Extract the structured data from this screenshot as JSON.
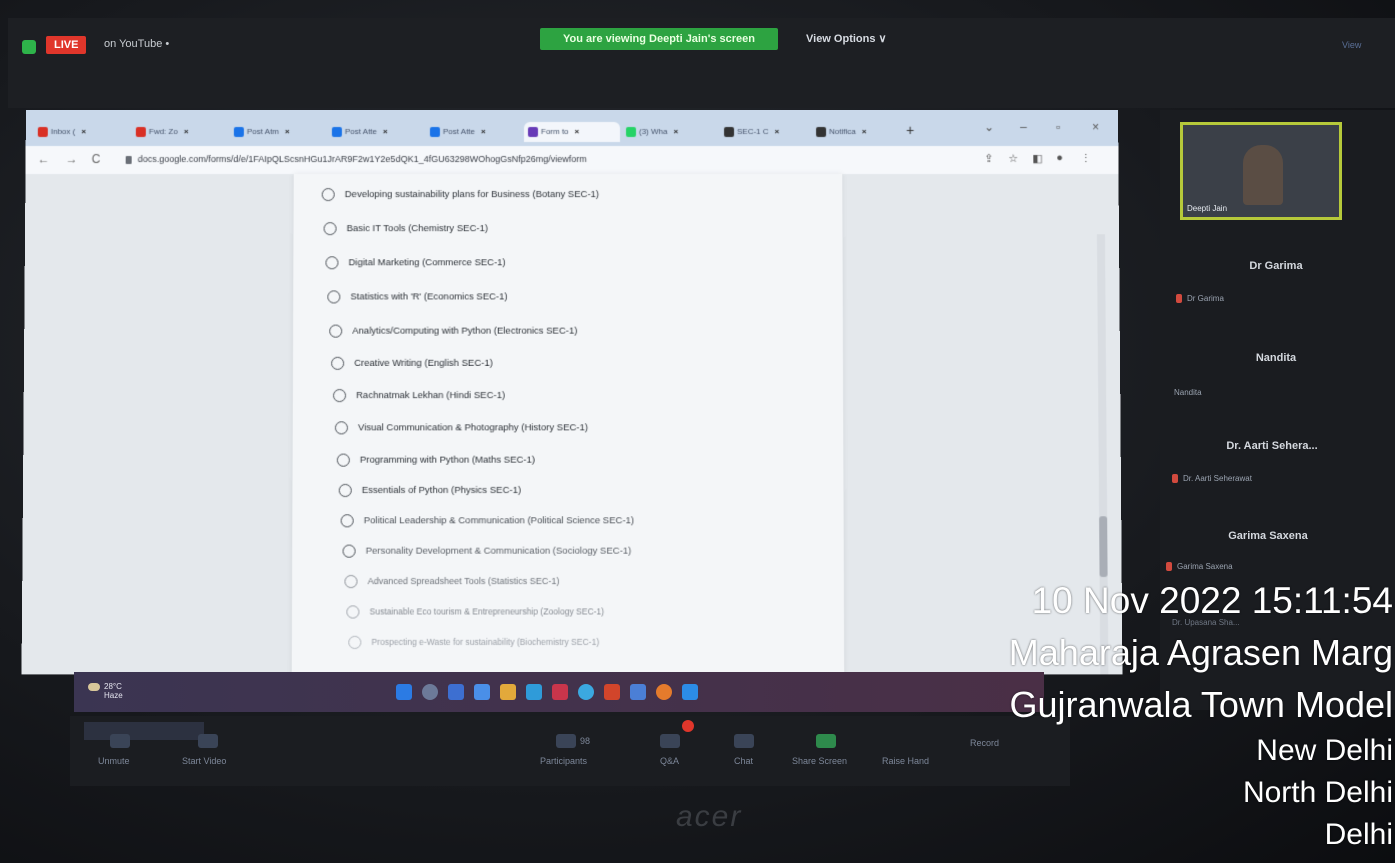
{
  "zoom": {
    "live_badge": "LIVE",
    "live_on": "on YouTube •",
    "viewing_banner": "You are viewing Deepti Jain's screen",
    "view_options": "View Options ∨",
    "view_corner": "View"
  },
  "browser": {
    "tabs": [
      {
        "label": "Inbox (",
        "color": "#d93025"
      },
      {
        "label": "Fwd: Zo",
        "color": "#d93025"
      },
      {
        "label": "Post Atm",
        "color": "#1a73e8"
      },
      {
        "label": "Post Atte",
        "color": "#1a73e8"
      },
      {
        "label": "Post Atte",
        "color": "#1a73e8"
      },
      {
        "label": "Form to",
        "color": "#673ab7"
      },
      {
        "label": "(3) Wha",
        "color": "#25d366"
      },
      {
        "label": "SEC-1 C",
        "color": "#333333"
      },
      {
        "label": "Notifica",
        "color": "#333333"
      }
    ],
    "url": "docs.google.com/forms/d/e/1FAIpQLScsnHGu1JrAR9F2w1Y2e5dQK1_4fGU63298WOhogGsNfp26mg/viewform",
    "options": [
      "Developing sustainability plans for Business (Botany SEC-1)",
      "Basic IT Tools (Chemistry SEC-1)",
      "Digital Marketing (Commerce SEC-1)",
      "Statistics with 'R' (Economics SEC-1)",
      "Analytics/Computing with Python (Electronics SEC-1)",
      "Creative Writing (English SEC-1)",
      "Rachnatmak Lekhan (Hindi SEC-1)",
      "Visual Communication & Photography (History SEC-1)",
      "Programming with Python (Maths SEC-1)",
      "Essentials of Python (Physics SEC-1)",
      "Political Leadership & Communication (Political Science SEC-1)",
      "Personality Development & Communication (Sociology SEC-1)",
      "Advanced Spreadsheet Tools (Statistics SEC-1)",
      "Sustainable Eco tourism & Entrepreneurship (Zoology SEC-1)",
      "Prospecting e-Waste for sustainability (Biochemistry SEC-1)"
    ]
  },
  "taskbar": {
    "temp": "28°C",
    "weather": "Haze"
  },
  "zoombar": {
    "unmute": "Unmute",
    "start_video": "Start Video",
    "participants_count": "98",
    "participants": "Participants",
    "qa": "Q&A",
    "chat": "Chat",
    "share": "Share Screen",
    "raise": "Raise Hand",
    "record": "Record"
  },
  "brand": "acer",
  "panel": {
    "video_name": "Deepti Jain",
    "people": [
      {
        "head": "Dr Garima",
        "sub": "Dr Garima"
      },
      {
        "head": "Nandita",
        "sub": "Nandita"
      },
      {
        "head": "Dr. Aarti Sehera...",
        "sub": "Dr. Aarti Seherawat"
      },
      {
        "head": "Garima Saxena",
        "sub": "Garima Saxena"
      }
    ],
    "last_partial": "Dr. Upasana Sha..."
  },
  "stamp": {
    "datetime": "10 Nov 2022 15:11:54",
    "line1": "Maharaja Agrasen Marg",
    "line2": "Gujranwala Town Model",
    "line3": "New Delhi",
    "line4": "North Delhi",
    "line5": "Delhi"
  }
}
